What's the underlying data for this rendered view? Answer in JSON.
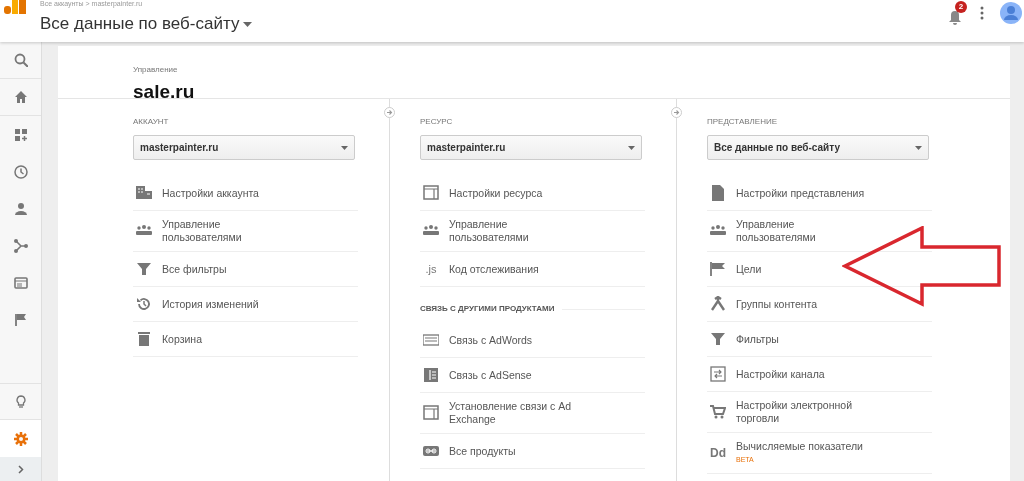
{
  "header": {
    "breadcrumb": "Все аккаунты > masterpainter.ru",
    "title": "Все данные по веб-сайту",
    "notification_count": "2"
  },
  "sidebar": {
    "items": [
      {
        "selected": false
      },
      {
        "selected": false
      },
      {
        "selected": false
      },
      {
        "selected": false
      },
      {
        "selected": false
      },
      {
        "selected": false
      },
      {
        "selected": false
      },
      {
        "selected": false
      },
      {
        "selected": false
      },
      {
        "selected": true
      }
    ]
  },
  "admin": {
    "label": "Управление",
    "site": "sale.ru"
  },
  "columns": [
    {
      "label": "АККАУНТ",
      "dropdown": "masterpainter.ru",
      "items": [
        {
          "kind": "link",
          "text": "Настройки аккаунта"
        },
        {
          "kind": "link",
          "text": "Управление пользователями"
        },
        {
          "kind": "link",
          "text": "Все фильтры"
        },
        {
          "kind": "link",
          "text": "История изменений"
        },
        {
          "kind": "link",
          "text": "Корзина"
        }
      ]
    },
    {
      "label": "РЕСУРС",
      "dropdown": "masterpainter.ru",
      "items": [
        {
          "kind": "link",
          "text": "Настройки ресурса"
        },
        {
          "kind": "link",
          "text": "Управление пользователями"
        },
        {
          "kind": "link",
          "text": "Код отслеживания",
          "icon_text": ".js"
        },
        {
          "kind": "heading",
          "text": "СВЯЗЬ С ДРУГИМИ ПРОДУКТАМИ"
        },
        {
          "kind": "link",
          "text": "Связь с AdWords"
        },
        {
          "kind": "link",
          "text": "Связь с AdSense"
        },
        {
          "kind": "link",
          "text": "Установление связи с Ad Exchange"
        },
        {
          "kind": "link",
          "text": "Все продукты"
        }
      ]
    },
    {
      "label": "ПРЕДСТАВЛЕНИЕ",
      "dropdown": "Все данные по веб-сайту",
      "items": [
        {
          "kind": "link",
          "text": "Настройки представления"
        },
        {
          "kind": "link",
          "text": "Управление пользователями"
        },
        {
          "kind": "link",
          "text": "Цели"
        },
        {
          "kind": "link",
          "text": "Группы контента"
        },
        {
          "kind": "link",
          "text": "Фильтры"
        },
        {
          "kind": "link",
          "text": "Настройки канала"
        },
        {
          "kind": "link",
          "text": "Настройки электронной торговли"
        },
        {
          "kind": "link",
          "text": "Вычисляемые показатели",
          "badge": "BETA",
          "icon_text": "Dd"
        }
      ]
    }
  ]
}
